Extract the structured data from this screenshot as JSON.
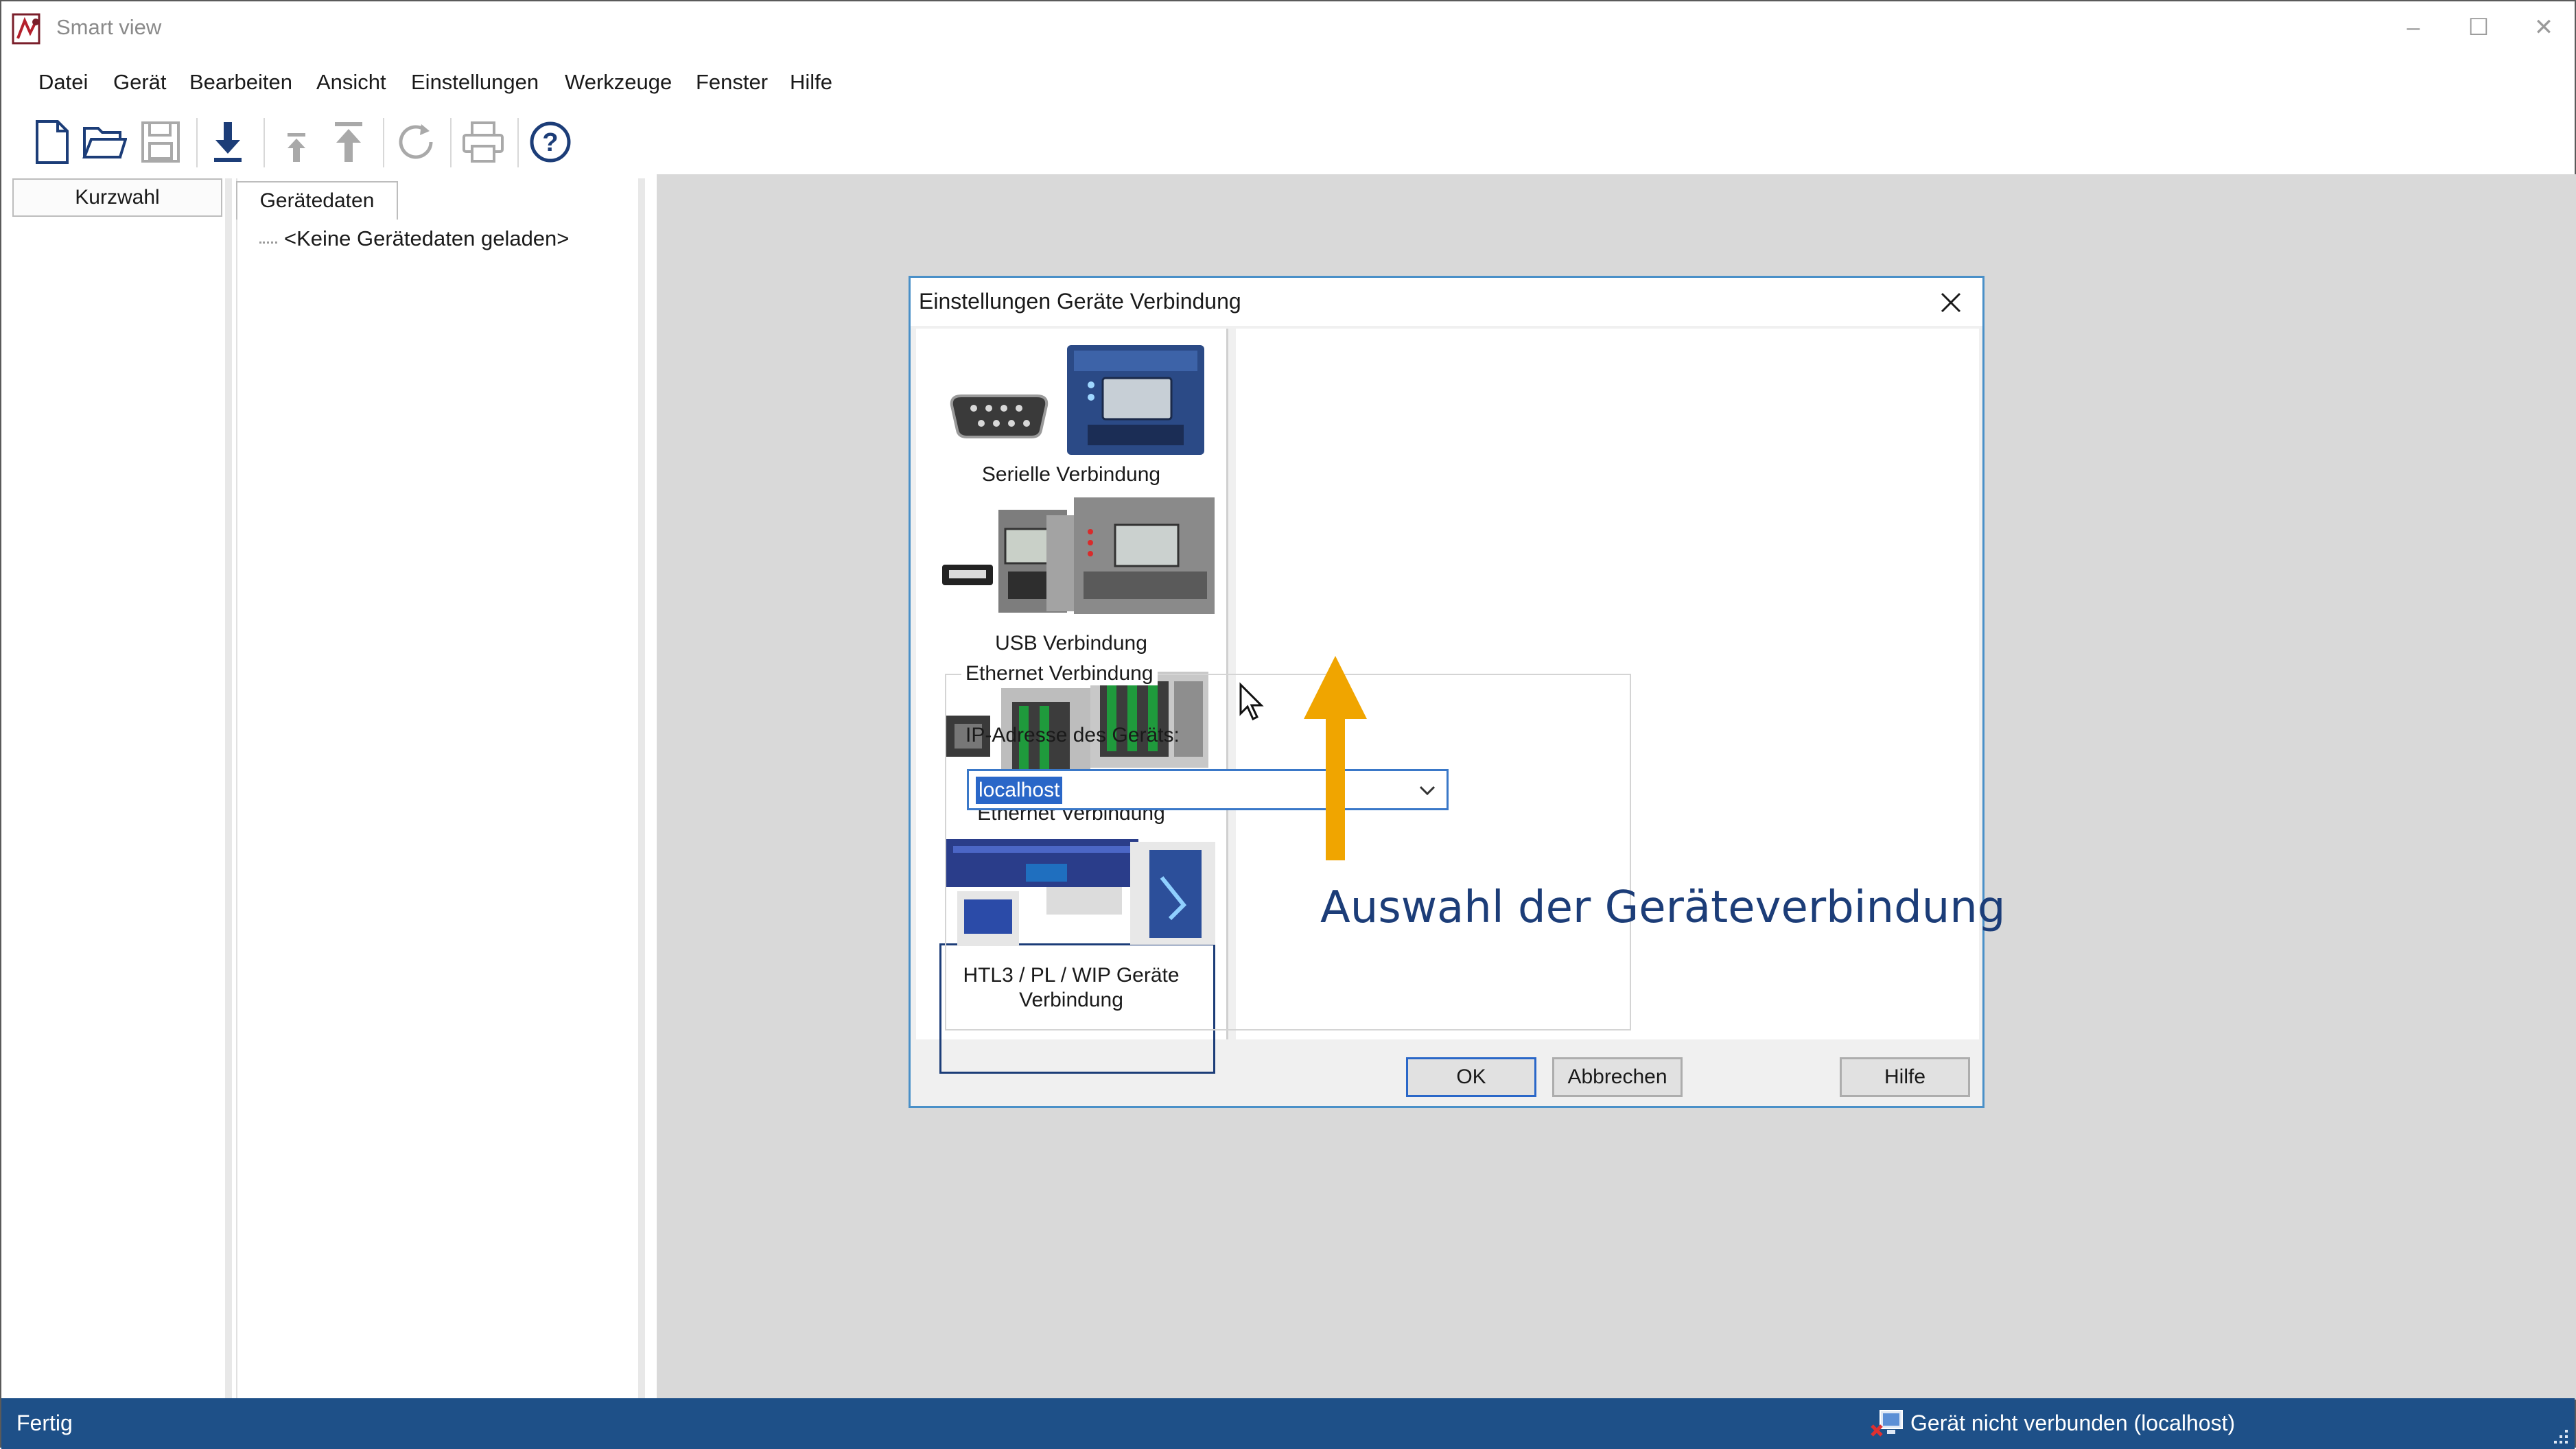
{
  "window": {
    "title": "Smart view",
    "controls": {
      "minimize": "–",
      "maximize": "☐",
      "close": "✕"
    }
  },
  "menu": [
    "Datei",
    "Gerät",
    "Bearbeiten",
    "Ansicht",
    "Einstellungen",
    "Werkzeuge",
    "Fenster",
    "Hilfe"
  ],
  "toolbar": {
    "icons": [
      "new-file-icon",
      "open-folder-icon",
      "save-icon",
      "download-icon",
      "upload-small-icon",
      "upload-icon",
      "refresh-icon",
      "print-icon",
      "help-icon"
    ],
    "help_glyph": "?"
  },
  "panels": {
    "kurzwahl_tab": "Kurzwahl",
    "geraetedaten_tab": "Gerätedaten",
    "tree_item": "<Keine Gerätedaten geladen>"
  },
  "dialog": {
    "title": "Einstellungen Geräte Verbindung",
    "connections": [
      {
        "label": "Serielle Verbindung"
      },
      {
        "label": "USB Verbindung"
      },
      {
        "label": "Ethernet Verbindung"
      },
      {
        "label_line1": "HTL3 / PL / WIP Geräte",
        "label_line2": "Verbindung"
      }
    ],
    "selected_connection": "Ethernet Verbindung",
    "group_title": "Ethernet Verbindung",
    "ip_label": "IP-Adresse des Geräts:",
    "ip_value": "localhost",
    "buttons": {
      "ok": "OK",
      "cancel": "Abbrechen",
      "help": "Hilfe"
    }
  },
  "annotation": {
    "text": "Auswahl der Geräteverbindung",
    "color": "#1c3d78",
    "arrow_color": "#f0a500"
  },
  "statusbar": {
    "left": "Fertig",
    "right": "Gerät nicht verbunden (localhost)",
    "color": "#1e5088"
  }
}
